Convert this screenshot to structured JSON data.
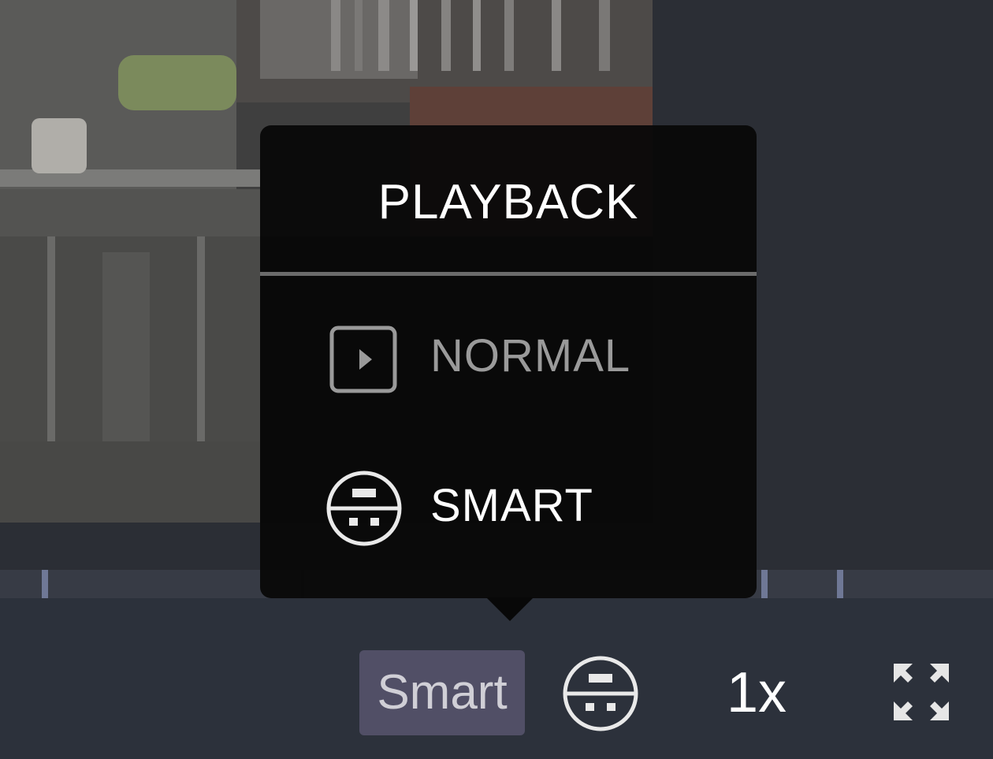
{
  "player": {
    "mode_label": "Smart",
    "speed_label": "1x",
    "mode_icon": "smart-mode-icon",
    "fullscreen_icon": "fullscreen-icon"
  },
  "playback_menu": {
    "title": "PLAYBACK",
    "items": [
      {
        "label": "NORMAL",
        "icon": "normal-play-icon",
        "selected": false
      },
      {
        "label": "SMART",
        "icon": "smart-mode-icon",
        "selected": true
      }
    ]
  },
  "colors": {
    "background": "#2b2e35",
    "controls_bar": "#2c313b",
    "mode_badge": "#514f66",
    "timeline": "#373b45",
    "timeline_tick": "#6f7896",
    "popup": "#080808"
  }
}
